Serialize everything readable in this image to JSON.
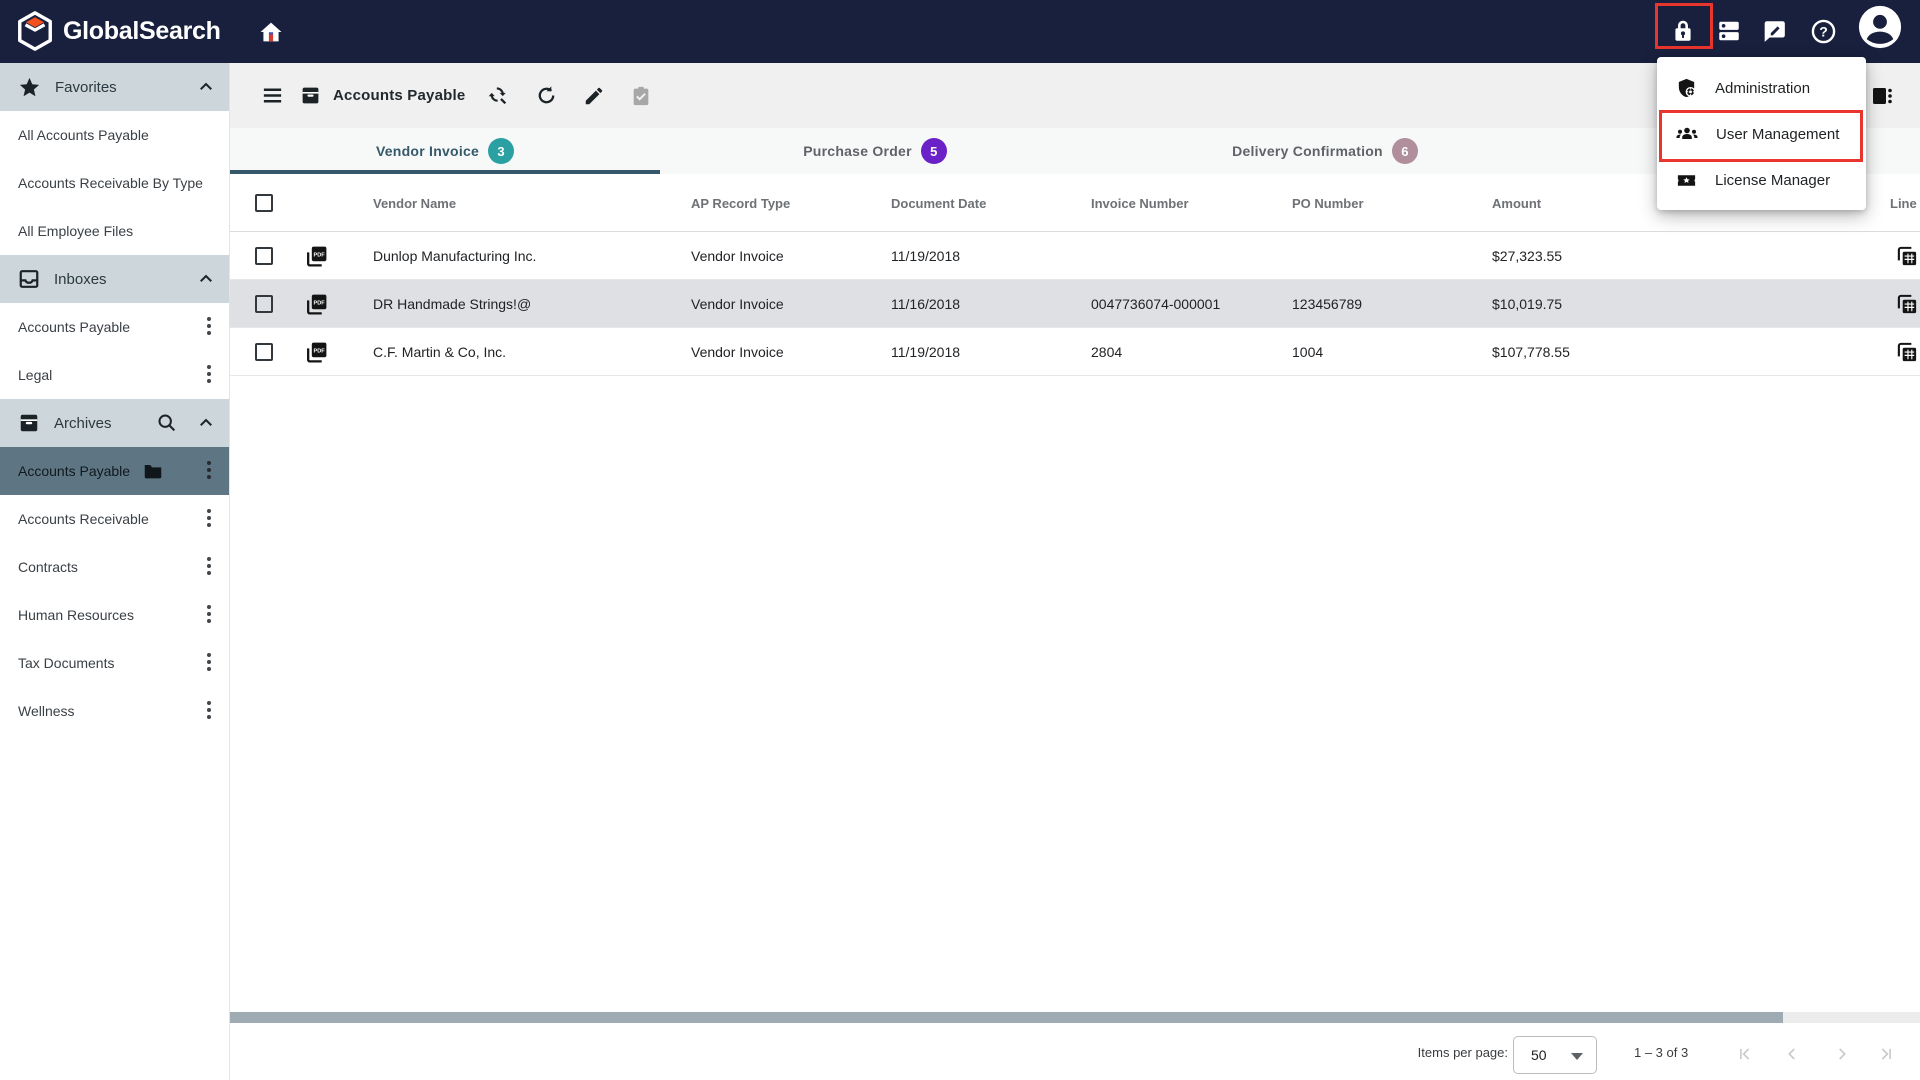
{
  "navbar": {
    "brand": "GlobalSearch",
    "icons": {
      "home": "home-icon",
      "lock": "lock-icon",
      "cards": "dns-icon",
      "feedback": "feedback-icon",
      "help": "help-icon",
      "avatar": "account-circle-icon"
    }
  },
  "sidebar": {
    "sections": [
      {
        "label": "Favorites",
        "icon": "star-icon",
        "items": [
          {
            "label": "All Accounts Payable"
          },
          {
            "label": "Accounts Receivable By Type"
          },
          {
            "label": "All Employee Files"
          }
        ]
      },
      {
        "label": "Inboxes",
        "icon": "inbox-icon",
        "items": [
          {
            "label": "Accounts Payable"
          },
          {
            "label": "Legal"
          }
        ]
      },
      {
        "label": "Archives",
        "icon": "archive-icon",
        "items": [
          {
            "label": "Accounts Payable",
            "selected": true
          },
          {
            "label": "Accounts Receivable"
          },
          {
            "label": "Contracts"
          },
          {
            "label": "Human Resources"
          },
          {
            "label": "Tax Documents"
          },
          {
            "label": "Wellness"
          }
        ]
      }
    ]
  },
  "toolbar": {
    "title": "Accounts Payable",
    "icons": {
      "menu": "hamburger-icon",
      "archive": "archive-icon",
      "find": "find-replace-icon",
      "refresh": "refresh-icon",
      "edit": "edit-icon",
      "tasks": "assignment-turned-in-icon",
      "view": "view-switch-icon"
    }
  },
  "tabs": [
    {
      "label": "Vendor Invoice",
      "count": "3",
      "badge_color": "#2aa0a2",
      "active": true
    },
    {
      "label": "Purchase Order",
      "count": "5",
      "badge_color": "#6a21c8",
      "active": false
    },
    {
      "label": "Delivery Confirmation",
      "count": "6",
      "badge_color": "#b08e9c",
      "active": false
    }
  ],
  "table": {
    "columns": [
      "Vendor Name",
      "AP Record Type",
      "Document Date",
      "Invoice Number",
      "PO Number",
      "Amount",
      "Line Items"
    ],
    "rows": [
      {
        "vendor": "Dunlop Manufacturing Inc.",
        "type": "Vendor Invoice",
        "date": "11/19/2018",
        "invoice": "",
        "po": "",
        "amount": "$27,323.55"
      },
      {
        "vendor": "DR Handmade Strings!@",
        "type": "Vendor Invoice",
        "date": "11/16/2018",
        "invoice": "0047736074-000001",
        "po": "123456789",
        "amount": "$10,019.75"
      },
      {
        "vendor": "C.F. Martin & Co, Inc.",
        "type": "Vendor Invoice",
        "date": "11/19/2018",
        "invoice": "2804",
        "po": "1004",
        "amount": "$107,778.55"
      }
    ]
  },
  "menu": {
    "items": [
      {
        "label": "Administration",
        "icon": "admin-shield-icon"
      },
      {
        "label": "User Management",
        "icon": "groups-icon",
        "highlighted": true
      },
      {
        "label": "License Manager",
        "icon": "license-ticket-icon"
      }
    ]
  },
  "pagination": {
    "items_per_page_label": "Items per page:",
    "page_size": "50",
    "range": "1 – 3 of 3"
  },
  "colors": {
    "navbar": "#19203d",
    "accent_red": "#e8352e",
    "active_tab": "#35596a",
    "selected_row": "#dfe0e3",
    "selected_archive": "#5e7683",
    "section_header": "#ccd6db"
  }
}
